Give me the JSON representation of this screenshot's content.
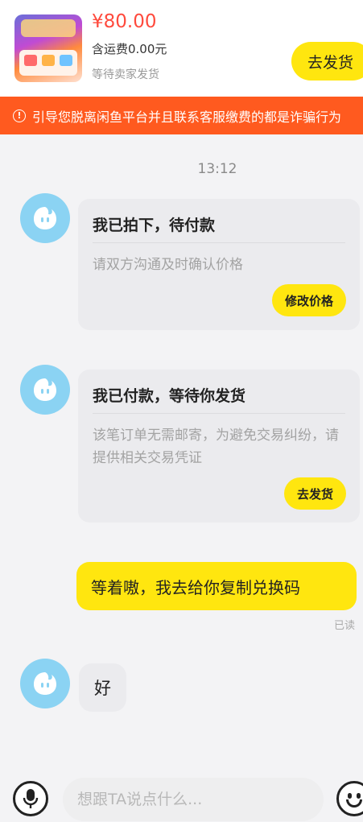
{
  "order": {
    "price": "¥80.00",
    "shipping_note": "含运费0.00元",
    "status": "等待卖家发货",
    "ship_button": "去发货"
  },
  "warning_banner": {
    "text": "引导您脱离闲鱼平台并且联系客服缴费的都是诈骗行为"
  },
  "chat": {
    "timestamp": "13:12",
    "cards": [
      {
        "title": "我已拍下，待付款",
        "description": "请双方沟通及时确认价格",
        "button": "修改价格"
      },
      {
        "title": "我已付款，等待你发货",
        "description": "该笔订单无需邮寄，为避免交易纠纷，请提供相关交易凭证",
        "button": "去发货"
      }
    ],
    "my_message": "等着嗷，我去给你复制兑换码",
    "read_status": "已读",
    "reply_message": "好"
  },
  "composer": {
    "placeholder": "想跟TA说点什么..."
  },
  "icons": {
    "avatar": "avatar-ghost-icon",
    "voice": "microphone-icon",
    "emoji": "smiley-icon",
    "warning": "exclamation-circle-icon"
  },
  "colors": {
    "accent_yellow": "#ffe60f",
    "price_red": "#ff4a3d",
    "warning_orange": "#ff5a1f",
    "avatar_blue": "#8bd3f3"
  }
}
